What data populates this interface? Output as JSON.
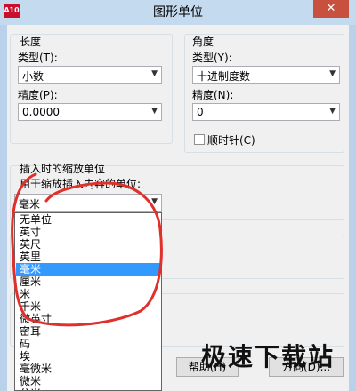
{
  "window": {
    "title": "图形单位",
    "close_glyph": "✕",
    "app_icon_text": "A10"
  },
  "length": {
    "group_label": "长度",
    "type_label": "类型(T):",
    "type_value": "小数",
    "precision_label": "精度(P):",
    "precision_value": "0.0000"
  },
  "angle": {
    "group_label": "角度",
    "type_label": "类型(Y):",
    "type_value": "十进制度数",
    "precision_label": "精度(N):",
    "precision_value": "0",
    "clockwise_label": "顺时针(C)",
    "clockwise_checked": false
  },
  "insert_scale": {
    "group_label": "插入时的缩放单位",
    "units_label": "用于缩放插入内容的单位:",
    "units_value": "毫米",
    "dropdown_options": [
      "无单位",
      "英寸",
      "英尺",
      "英里",
      "毫米",
      "厘米",
      "米",
      "千米",
      "微英寸",
      "密耳",
      "码",
      "埃",
      "毫微米",
      "微米",
      "分米"
    ],
    "selected_option": "毫米"
  },
  "buttons": {
    "help_partial": "帮助(H)",
    "direction_partial": "方向(D)..."
  },
  "watermark": "极速下载站",
  "annotation_color": "#e0302c"
}
